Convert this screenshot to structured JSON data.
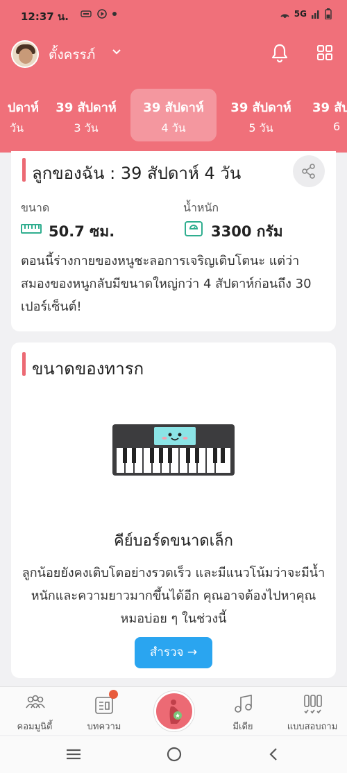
{
  "status_bar": {
    "time": "12:37 น.",
    "network": "5G",
    "icons": [
      "notification-icon",
      "play-icon",
      "dot-icon",
      "hotspot-icon",
      "signal-icon",
      "battery-icon"
    ]
  },
  "header": {
    "profile_name": "ตั้งครรภ์",
    "icons": [
      "avatar",
      "chevron-down-icon",
      "bell-icon",
      "grid-icon"
    ]
  },
  "week_tabs": [
    {
      "week": "ปดาห์",
      "day": "วัน",
      "active": false
    },
    {
      "week": "39 สัปดาห์",
      "day": "3 วัน",
      "active": false
    },
    {
      "week": "39 สัปดาห์",
      "day": "4 วัน",
      "active": true
    },
    {
      "week": "39 สัปดาห์",
      "day": "5 วัน",
      "active": false
    },
    {
      "week": "39 สัป",
      "day": "6",
      "active": false
    }
  ],
  "baby_card": {
    "title": "ลูกของฉัน : 39 สัปดาห์ 4  วัน",
    "size_label": "ขนาด",
    "size_value": "50.7 ซม.",
    "weight_label": "น้ำหนัก",
    "weight_value": "3300 กรัม",
    "description": "ตอนนี้ร่างกายของหนูชะลอการเจริญเติบโตนะ แต่ว่าสมองของหนูกลับมีขนาดใหญ่กว่า 4 สัปดาห์ก่อนถึง 30 เปอร์เซ็นต์!"
  },
  "size_card": {
    "title": "ขนาดของทารก",
    "item_name": "คีย์บอร์ดขนาดเล็ก",
    "item_description": "ลูกน้อยยังคงเติบโตอย่างรวดเร็ว และมีแนวโน้มว่าจะมีน้ำหนักและความยาวมากขึ้นได้อีก คุณอาจต้องไปหาคุณหมอบ่อย ๆ ในช่วงนี้",
    "button_label": "สำรวจ →"
  },
  "bottom_nav": [
    {
      "label": "คอมมูนิตี้",
      "icon": "community-icon"
    },
    {
      "label": "บทความ",
      "icon": "article-icon"
    },
    {
      "label": "",
      "icon": "pregnancy-icon"
    },
    {
      "label": "มีเดีย",
      "icon": "music-icon"
    },
    {
      "label": "แบบสอบถาม",
      "icon": "poll-icon"
    }
  ],
  "colors": {
    "accent": "#f0707a",
    "accent_bar": "#ec6a74",
    "button": "#2aa5f0",
    "teal_icon": "#2fae8f"
  }
}
